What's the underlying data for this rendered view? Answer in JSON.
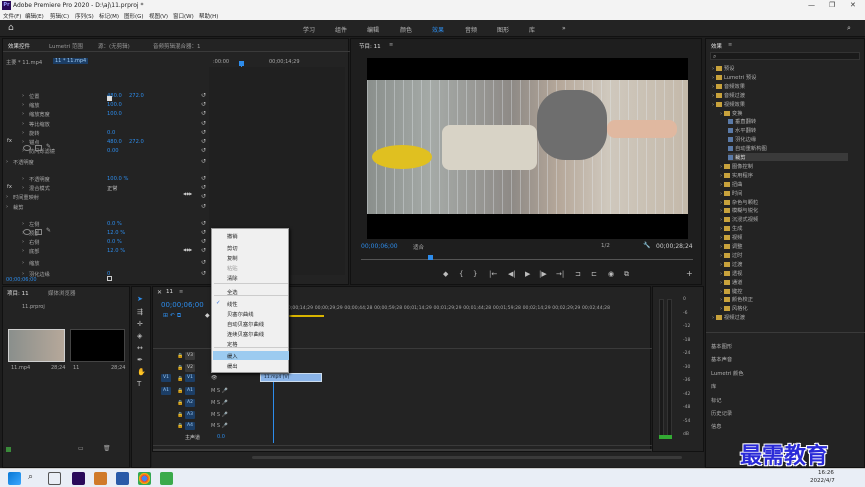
{
  "title_bar": {
    "logo": "Pr",
    "title": "Adobe Premiere Pro 2020 - D:\\aj\\11.prproj *"
  },
  "menu": [
    "文件(F)",
    "编辑(E)",
    "剪辑(C)",
    "序列(S)",
    "标记(M)",
    "图形(G)",
    "视图(V)",
    "窗口(W)",
    "帮助(H)"
  ],
  "workspaces": [
    "学习",
    "组件",
    "编辑",
    "颜色",
    "效果",
    "音频",
    "图形",
    "库"
  ],
  "active_workspace": "效果",
  "effect_controls": {
    "tabs": [
      "效果控件",
      "Lumetri 范围",
      "源：(无剪辑)",
      "音频剪辑混合器：1"
    ],
    "clip": "主要 * 11.mp4",
    "seq": "11 * 11.mp4",
    "ruler_start": ":00:00",
    "ruler_mid": "00;00;14;29",
    "rows": [
      {
        "label": "位置",
        "v1": "480.0",
        "v2": "272.0"
      },
      {
        "label": "缩放",
        "v1": "100.0",
        "v2": ""
      },
      {
        "label": "缩放宽度",
        "v1": "100.0",
        "v2": ""
      },
      {
        "label": "等比缩放",
        "v1": "",
        "v2": ""
      },
      {
        "label": "旋转",
        "v1": "0.0",
        "v2": ""
      },
      {
        "label": "锚点",
        "v1": "480.0",
        "v2": "272.0"
      },
      {
        "label": "防闪烁滤镜",
        "v1": "0.00",
        "v2": ""
      },
      {
        "label": "不透明度",
        "v1": "",
        "v2": ""
      },
      {
        "label": "不透明度",
        "v1": "100.0 %",
        "v2": ""
      },
      {
        "label": "混合模式",
        "v1": "正常",
        "v2": ""
      },
      {
        "label": "时间重映射",
        "v1": "",
        "v2": ""
      },
      {
        "label": "裁剪",
        "v1": "",
        "v2": ""
      },
      {
        "label": "左侧",
        "v1": "0.0 %",
        "v2": ""
      },
      {
        "label": "顶部",
        "v1": "12.0 %",
        "v2": ""
      },
      {
        "label": "右侧",
        "v1": "0.0 %",
        "v2": ""
      },
      {
        "label": "底部",
        "v1": "12.0 %",
        "v2": ""
      },
      {
        "label": "缩放",
        "v1": "",
        "v2": ""
      },
      {
        "label": "羽化边缘",
        "v1": "0",
        "v2": ""
      }
    ],
    "fx_labels": [
      "fx",
      "fx"
    ],
    "timecode": "00;00;06;00"
  },
  "program": {
    "tab": "节目: 11",
    "timecode": "00;00;06;00",
    "fit": "适合",
    "quality": "1/2",
    "duration": "00;00;28;24"
  },
  "effects_panel": {
    "title": "效果",
    "items": [
      "预设",
      "Lumetri 预设",
      "音频效果",
      "音频过渡",
      "视频效果",
      "变换",
      "垂直翻转",
      "水平翻转",
      "羽化边缘",
      "自动重新构图",
      "裁剪",
      "图像控制",
      "实用程序",
      "扭曲",
      "时间",
      "杂色与颗粒",
      "模糊与锐化",
      "沉浸式视频",
      "生成",
      "视频",
      "调整",
      "过时",
      "过渡",
      "透视",
      "通道",
      "键控",
      "颜色校正",
      "风格化",
      "视频过渡"
    ],
    "panels_below": [
      "基本图形",
      "基本声音",
      "Lumetri 颜色",
      "库",
      "标记",
      "历史记录",
      "信息"
    ]
  },
  "project": {
    "tabs": [
      "项目: 11",
      "媒体浏览器"
    ],
    "file": "11.prproj",
    "thumbs": [
      {
        "name": "11.mp4",
        "dur": "28;24"
      },
      {
        "name": "11",
        "dur": "28;24"
      }
    ]
  },
  "timeline": {
    "tab": "11",
    "timecode": "00;00;06;00",
    "ruler": [
      "00;00;14;29",
      "00;00;29;29",
      "00;00;44;28",
      "00;00;59;28",
      "00;01;14;29",
      "00;01;29;29",
      "00;01;44;28",
      "00;01;59;28",
      "00;02;14;29",
      "00;02;29;29",
      "00;02;44;28"
    ],
    "video_tracks": [
      "V3",
      "V2",
      "V1"
    ],
    "audio_tracks": [
      "A1",
      "A2",
      "A3",
      "A4"
    ],
    "master": "主声道",
    "master_val": "0.0",
    "clip": "11.mp4 [V]"
  },
  "context_menu": {
    "items": [
      {
        "label": "撤销",
        "disabled": false
      },
      {
        "label": "剪切",
        "disabled": false
      },
      {
        "label": "复制",
        "disabled": false
      },
      {
        "label": "粘贴",
        "disabled": true
      },
      {
        "label": "清除",
        "disabled": false
      },
      {
        "label": "全选",
        "disabled": false
      },
      {
        "label": "线性",
        "disabled": false,
        "checked": true
      },
      {
        "label": "贝塞尔曲线",
        "disabled": false
      },
      {
        "label": "自动贝塞尔曲线",
        "disabled": false
      },
      {
        "label": "连续贝塞尔曲线",
        "disabled": false
      },
      {
        "label": "定格",
        "disabled": false
      },
      {
        "label": "缓入",
        "disabled": false,
        "highlighted": true
      },
      {
        "label": "缓出",
        "disabled": false
      }
    ]
  },
  "meter": {
    "ticks": [
      "0",
      "-6",
      "-12",
      "-18",
      "-24",
      "-30",
      "-36",
      "-42",
      "-48",
      "-54",
      "dB"
    ],
    "bottom": "S S"
  },
  "taskbar": {
    "time": "16:26",
    "date": "2022/4/7"
  },
  "watermark": "最需教育",
  "colors": {
    "accent": "#2d8ceb",
    "ctx_highlight": "#9ccbf0",
    "timeline_clip": "#8ab4e8"
  }
}
